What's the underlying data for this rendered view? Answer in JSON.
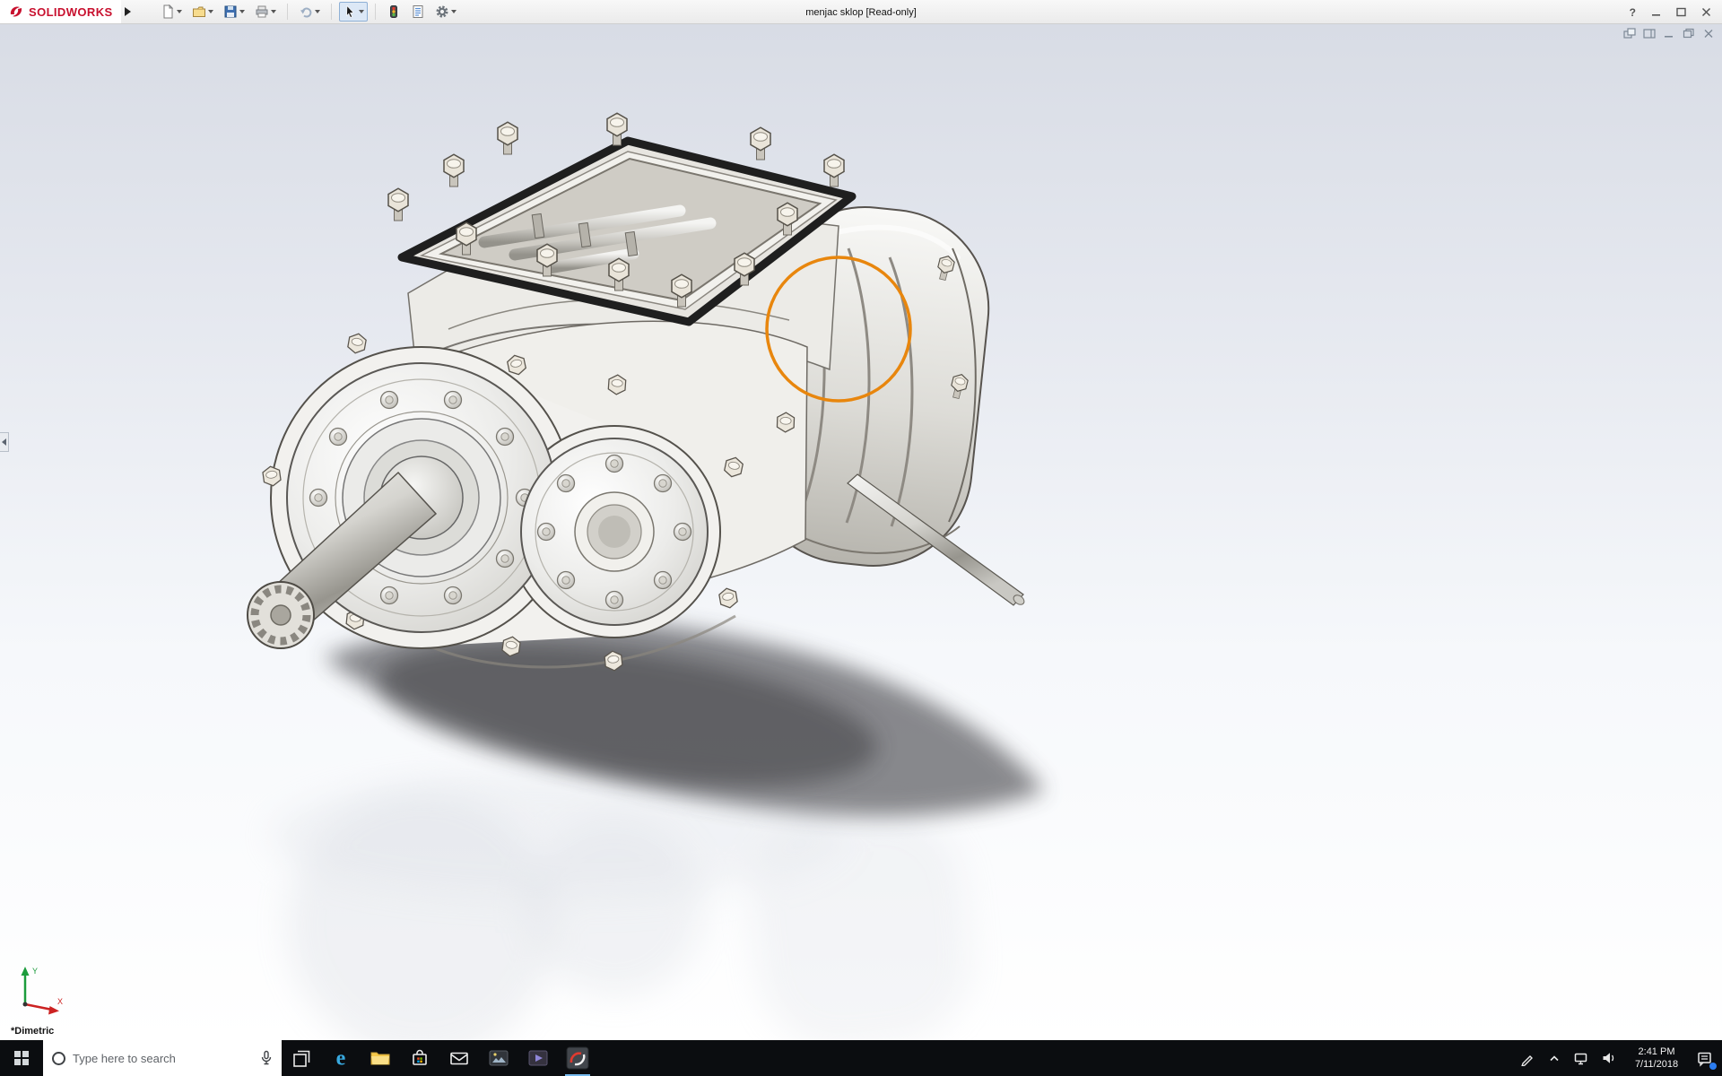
{
  "app": {
    "logo_text": "SOLIDWORKS",
    "doc_title": "menjac sklop [Read-only]",
    "help_glyph": "?"
  },
  "toolbar": {
    "icons": [
      "new-document",
      "open",
      "save",
      "print",
      "undo",
      "select",
      "rebuild",
      "file-properties",
      "options"
    ]
  },
  "doc_window_controls": [
    "cascade",
    "pane",
    "minimize",
    "restore",
    "close"
  ],
  "viewport": {
    "view_label": "*Dimetric",
    "triad": {
      "x_label": "X",
      "y_label": "Y"
    },
    "annotation_color": "#E8860D"
  },
  "taskbar": {
    "search_placeholder": "Type here to search",
    "edge_glyph": "e",
    "icons": [
      "start",
      "search",
      "task-view",
      "edge",
      "file-explorer",
      "store",
      "mail",
      "photos",
      "movies",
      "solidworks"
    ],
    "tray": [
      "pen",
      "hidden-icons",
      "network",
      "volume",
      "clock",
      "action-center"
    ],
    "clock": {
      "time": "2:41 PM",
      "date": "7/11/2018"
    }
  },
  "colors": {
    "brand_red": "#C8102E",
    "annotation_orange": "#E8860D",
    "taskbar_bg": "#0B0D10"
  }
}
